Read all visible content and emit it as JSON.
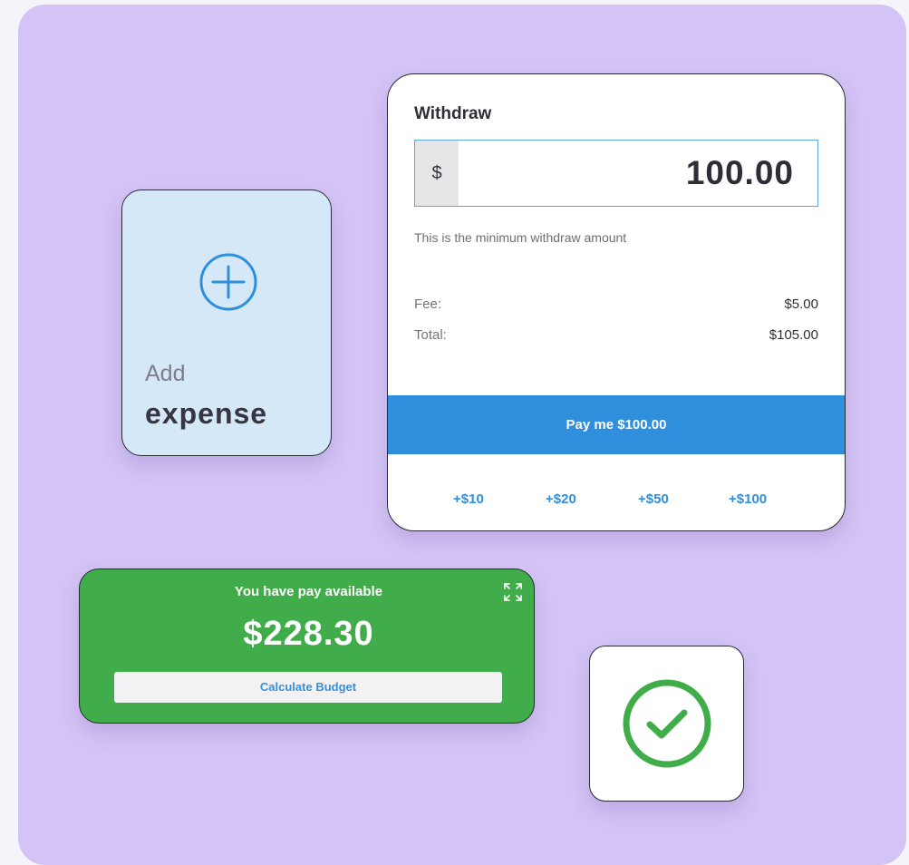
{
  "expense_card": {
    "line1": "Add",
    "line2": "expense",
    "icon": "plus-circle-icon",
    "accent_color": "#2f8fdc"
  },
  "withdraw": {
    "title": "Withdraw",
    "currency_symbol": "$",
    "amount": "100.00",
    "hint": "This is the minimum withdraw amount",
    "fee_label": "Fee:",
    "fee_value": "$5.00",
    "total_label": "Total:",
    "total_value": "$105.00",
    "pay_button": "Pay me $100.00",
    "quick_amounts": [
      "+$10",
      "+$20",
      "+$50",
      "+$100"
    ],
    "button_color": "#2f8fdc"
  },
  "pay_available": {
    "title": "You have pay available",
    "amount": "$228.30",
    "calc_button": "Calculate Budget",
    "expand_icon": "expand-icon",
    "background_color": "#41ad4a"
  },
  "status": {
    "icon": "check-circle-icon",
    "color": "#41ad4a"
  }
}
